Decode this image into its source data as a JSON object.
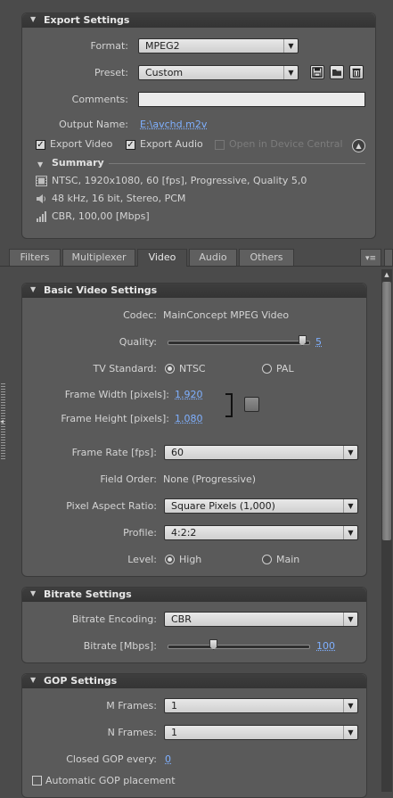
{
  "export_settings": {
    "title": "Export Settings",
    "format_label": "Format:",
    "format_value": "MPEG2",
    "preset_label": "Preset:",
    "preset_value": "Custom",
    "comments_label": "Comments:",
    "comments_value": "",
    "output_name_label": "Output Name:",
    "output_name_value": "E:\\avchd.m2v",
    "export_video_label": "Export Video",
    "export_video_checked": true,
    "export_audio_label": "Export Audio",
    "export_audio_checked": true,
    "device_central_label": "Open in Device Central",
    "summary_title": "Summary",
    "summary_video": "NTSC, 1920x1080, 60 [fps], Progressive, Quality 5,0",
    "summary_audio": "48 kHz, 16 bit, Stereo, PCM",
    "summary_bitrate": "CBR, 100,00 [Mbps]",
    "icons": [
      "save-preset-icon",
      "import-preset-icon",
      "delete-preset-icon",
      "collapse-up-icon"
    ]
  },
  "tabs": [
    {
      "label": "Filters",
      "active": false
    },
    {
      "label": "Multiplexer",
      "active": false
    },
    {
      "label": "Video",
      "active": true
    },
    {
      "label": "Audio",
      "active": false
    },
    {
      "label": "Others",
      "active": false
    }
  ],
  "basic_video": {
    "title": "Basic Video Settings",
    "codec_label": "Codec:",
    "codec_value": "MainConcept MPEG Video",
    "quality_label": "Quality:",
    "quality_value": "5",
    "quality_fraction": 0.96,
    "tv_standard_label": "TV Standard:",
    "tv_ntsc": "NTSC",
    "tv_pal": "PAL",
    "tv_selected": "NTSC",
    "frame_width_label": "Frame Width [pixels]:",
    "frame_width_value": "1.920",
    "frame_height_label": "Frame Height [pixels]:",
    "frame_height_value": "1.080",
    "frame_rate_label": "Frame Rate [fps]:",
    "frame_rate_value": "60",
    "field_order_label": "Field Order:",
    "field_order_value": "None (Progressive)",
    "par_label": "Pixel Aspect Ratio:",
    "par_value": "Square Pixels (1,000)",
    "profile_label": "Profile:",
    "profile_value": "4:2:2",
    "level_label": "Level:",
    "level_high": "High",
    "level_main": "Main",
    "level_selected": "High"
  },
  "bitrate": {
    "title": "Bitrate Settings",
    "encoding_label": "Bitrate Encoding:",
    "encoding_value": "CBR",
    "bitrate_label": "Bitrate [Mbps]:",
    "bitrate_value": "100",
    "bitrate_fraction": 0.33
  },
  "gop": {
    "title": "GOP Settings",
    "m_frames_label": "M Frames:",
    "m_frames_value": "1",
    "n_frames_label": "N Frames:",
    "n_frames_value": "1",
    "closed_gop_label": "Closed GOP every:",
    "closed_gop_value": "0",
    "auto_gop_label": "Automatic GOP placement"
  },
  "colors": {
    "background": "#4b4b4b",
    "panel": "#5a5a5a",
    "header": "#383838",
    "link": "#7fb0ff"
  }
}
